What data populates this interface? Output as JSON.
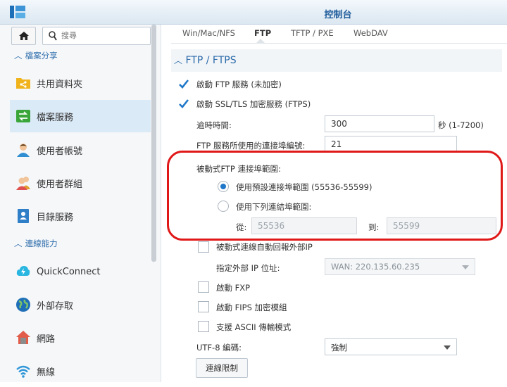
{
  "window": {
    "title": "控制台"
  },
  "sidebar": {
    "search_placeholder": "搜尋",
    "sections": [
      {
        "label": "檔案分享"
      },
      {
        "label": "連線能力"
      }
    ],
    "items": [
      {
        "label": "共用資料夾",
        "icon": "shared-folder-icon"
      },
      {
        "label": "檔案服務",
        "icon": "file-services-icon",
        "active": true
      },
      {
        "label": "使用者帳號",
        "icon": "user-icon"
      },
      {
        "label": "使用者群組",
        "icon": "group-icon"
      },
      {
        "label": "目錄服務",
        "icon": "directory-icon"
      },
      {
        "label": "QuickConnect",
        "icon": "quickconnect-icon"
      },
      {
        "label": "外部存取",
        "icon": "external-access-icon"
      },
      {
        "label": "網路",
        "icon": "network-icon"
      },
      {
        "label": "無線",
        "icon": "wireless-icon"
      }
    ]
  },
  "tabs": [
    {
      "label": "Win/Mac/NFS"
    },
    {
      "label": "FTP",
      "active": true
    },
    {
      "label": "TFTP / PXE"
    },
    {
      "label": "WebDAV"
    }
  ],
  "ftp": {
    "section_title": "FTP / FTPS",
    "enable_ftp": {
      "label": "啟動 FTP 服務 (未加密)",
      "checked": true
    },
    "enable_ftps": {
      "label": "啟動 SSL/TLS 加密服務 (FTPS)",
      "checked": true
    },
    "timeout": {
      "label": "逾時時間:",
      "value": "300",
      "unit": "秒 (1-7200)"
    },
    "port": {
      "label": "FTP 服務所使用的連接埠編號:",
      "value": "21"
    },
    "passive": {
      "label": "被動式FTP 連接埠範圍:",
      "default_option": "使用預設連接埠範圍 (55536-55599)",
      "custom_option": "使用下列連結埠範圍:",
      "from_label": "從:",
      "from_value": "55536",
      "to_label": "到:",
      "to_value": "55599"
    },
    "passive_ext_ip": {
      "label": "被動式連線自動回報外部IP",
      "checked": false
    },
    "external_ip": {
      "label": "指定外部 IP 位址:",
      "value": "WAN: 220.135.60.235"
    },
    "enable_fxp": {
      "label": "啟動 FXP",
      "checked": false
    },
    "enable_fips": {
      "label": "啟動 FIPS 加密模組",
      "checked": false
    },
    "ascii_mode": {
      "label": "支援 ASCII 傳輸模式",
      "checked": false
    },
    "utf8": {
      "label": "UTF-8 編碼:",
      "value": "強制"
    },
    "connection_limit_button": "連線限制"
  }
}
